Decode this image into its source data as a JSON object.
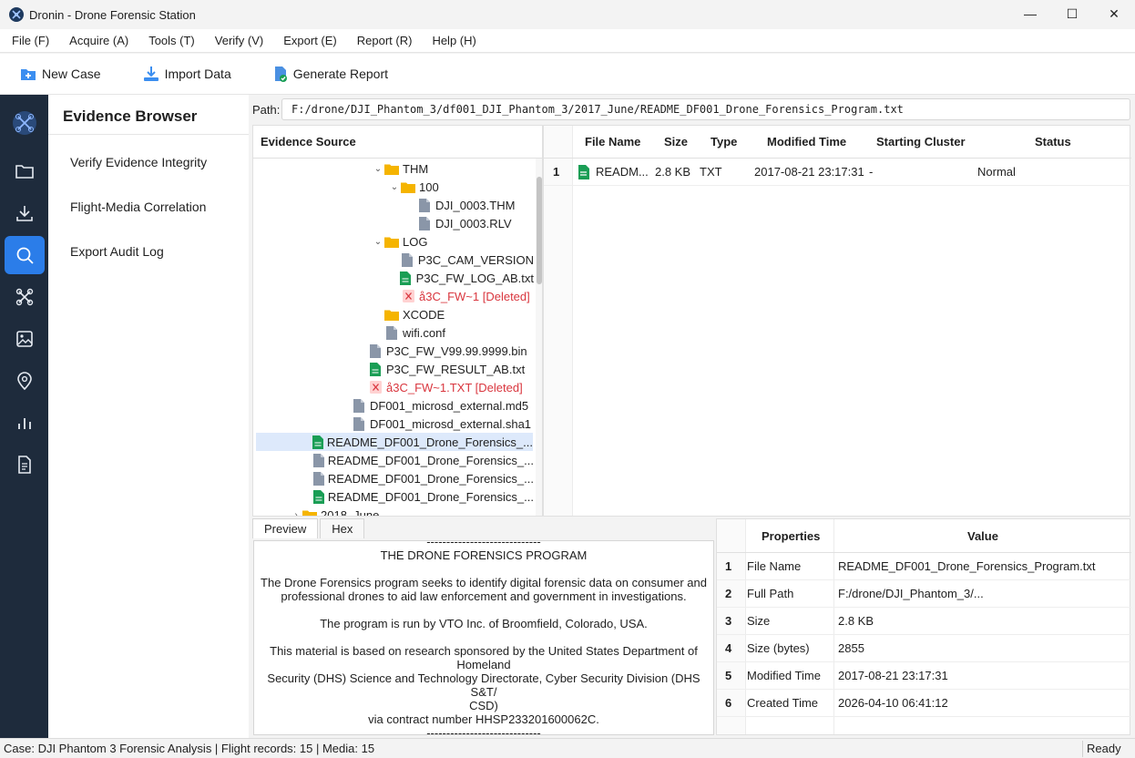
{
  "window": {
    "title": "Dronin - Drone Forensic Station",
    "minimize": "—",
    "maximize": "☐",
    "close": "✕"
  },
  "menu": [
    "File (F)",
    "Acquire (A)",
    "Tools (T)",
    "Verify (V)",
    "Export (E)",
    "Report (R)",
    "Help (H)"
  ],
  "toolbar": {
    "new_case": "New Case",
    "import_data": "Import Data",
    "generate_report": "Generate Report"
  },
  "rail_icons": [
    "drone-logo-icon",
    "folder-icon",
    "download-icon",
    "search-icon",
    "drone-icon",
    "image-icon",
    "location-pin-icon",
    "bar-chart-icon",
    "document-icon"
  ],
  "nav": {
    "title": "Evidence Browser",
    "items": [
      "Verify Evidence Integrity",
      "Flight-Media Correlation",
      "Export Audit Log"
    ]
  },
  "path": {
    "label": "Path:",
    "value": "F:/drone/DJI_Phantom_3/df001_DJI_Phantom_3/2017_June/README_DF001_Drone_Forensics_Program.txt"
  },
  "tree": {
    "header": "Evidence Source",
    "rows": [
      {
        "label": "THM",
        "indent": 7,
        "type": "folder",
        "chev": "⌄"
      },
      {
        "label": "100",
        "indent": 8,
        "type": "folder",
        "chev": "⌄"
      },
      {
        "label": "DJI_0003.THM",
        "indent": 9,
        "type": "file",
        "chev": ""
      },
      {
        "label": "DJI_0003.RLV",
        "indent": 9,
        "type": "file",
        "chev": ""
      },
      {
        "label": "LOG",
        "indent": 7,
        "type": "folder",
        "chev": "⌄"
      },
      {
        "label": "P3C_CAM_VERSION",
        "indent": 8,
        "type": "file",
        "chev": ""
      },
      {
        "label": "P3C_FW_LOG_AB.txt",
        "indent": 8,
        "type": "text",
        "chev": ""
      },
      {
        "label": "å3C_FW~1 [Deleted]",
        "indent": 8,
        "type": "deleted",
        "chev": ""
      },
      {
        "label": "XCODE",
        "indent": 7,
        "type": "folder",
        "chev": ""
      },
      {
        "label": "wifi.conf",
        "indent": 7,
        "type": "file",
        "chev": ""
      },
      {
        "label": "P3C_FW_V99.99.9999.bin",
        "indent": 6,
        "type": "file",
        "chev": ""
      },
      {
        "label": "P3C_FW_RESULT_AB.txt",
        "indent": 6,
        "type": "text",
        "chev": ""
      },
      {
        "label": "å3C_FW~1.TXT [Deleted]",
        "indent": 6,
        "type": "deleted",
        "chev": ""
      },
      {
        "label": "DF001_microsd_external.md5",
        "indent": 5,
        "type": "file",
        "chev": ""
      },
      {
        "label": "DF001_microsd_external.sha1",
        "indent": 5,
        "type": "file",
        "chev": ""
      },
      {
        "label": "README_DF001_Drone_Forensics_...",
        "indent": 4,
        "type": "text",
        "chev": "",
        "selected": true
      },
      {
        "label": "README_DF001_Drone_Forensics_...",
        "indent": 4,
        "type": "file",
        "chev": ""
      },
      {
        "label": "README_DF001_Drone_Forensics_...",
        "indent": 4,
        "type": "file",
        "chev": ""
      },
      {
        "label": "README_DF001_Drone_Forensics_...",
        "indent": 4,
        "type": "text",
        "chev": ""
      },
      {
        "label": "2018_June",
        "indent": 2,
        "type": "folder",
        "chev": "›"
      }
    ]
  },
  "files": {
    "columns": [
      "File Name",
      "Size",
      "Type",
      "Modified Time",
      "Starting Cluster",
      "Status"
    ],
    "rows": [
      {
        "num": "1",
        "name": "READM...",
        "size": "2.8 KB",
        "type": "TXT",
        "modified": "2017-08-21 23:17:31",
        "cluster": "-",
        "status": "Normal"
      }
    ]
  },
  "tabs": [
    "Preview",
    "Hex"
  ],
  "preview": {
    "lines": [
      "-----------------------------",
      "THE DRONE FORENSICS PROGRAM",
      "",
      "The Drone Forensics program seeks to identify digital forensic data on consumer and",
      "professional drones to aid law enforcement and government in investigations.",
      "",
      "The program is run by VTO Inc. of Broomfield, Colorado, USA.",
      "",
      "This material is based on research sponsored by the United States Department of",
      "Homeland",
      "Security (DHS) Science and Technology Directorate, Cyber Security Division (DHS S&T/",
      "CSD)",
      "via contract number HHSP233201600062C.",
      "-----------------------------"
    ]
  },
  "properties": {
    "columns": [
      "Properties",
      "Value"
    ],
    "rows": [
      {
        "num": "1",
        "key": "File Name",
        "value": "README_DF001_Drone_Forensics_Program.txt"
      },
      {
        "num": "2",
        "key": "Full Path",
        "value": "F:/drone/DJI_Phantom_3/..."
      },
      {
        "num": "3",
        "key": "Size",
        "value": "2.8 KB"
      },
      {
        "num": "4",
        "key": "Size (bytes)",
        "value": "2855"
      },
      {
        "num": "5",
        "key": "Modified Time",
        "value": "2017-08-21 23:17:31"
      },
      {
        "num": "6",
        "key": "Created Time",
        "value": "2026-04-10 06:41:12"
      }
    ]
  },
  "status": {
    "left": "Case: DJI Phantom 3 Forensic Analysis | Flight records: 15 | Media: 15",
    "right": "Ready"
  },
  "colors": {
    "rail_bg": "#1e2b3c",
    "accent": "#2b7de9",
    "folder": "#f5b400",
    "text_file": "#1a9e55",
    "generic_file": "#8a96a8",
    "deleted": "#d9363e"
  }
}
